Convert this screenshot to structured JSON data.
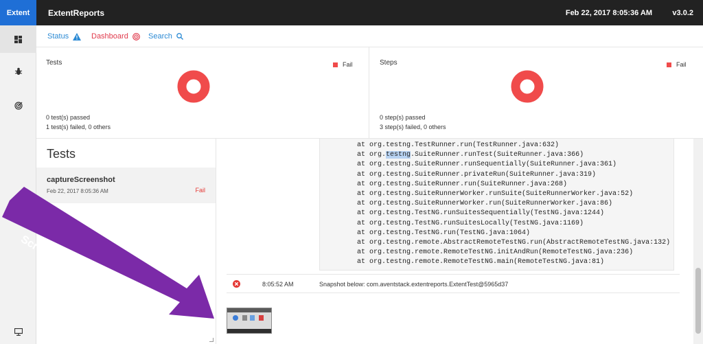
{
  "topbar": {
    "brand": "Extent",
    "title": "ExtentReports",
    "datetime": "Feb 22, 2017 8:05:36 AM",
    "version": "v3.0.2",
    "bg_color": "#222222",
    "brand_color": "#1f6fd6"
  },
  "sidebar": {
    "items": [
      {
        "icon": "dashboard-grid-icon",
        "active": true
      },
      {
        "icon": "bug-icon",
        "active": false
      },
      {
        "icon": "radar-icon",
        "active": false
      },
      {
        "icon": "monitor-icon",
        "active": false
      }
    ]
  },
  "subnav": {
    "status_label": "Status",
    "dashboard_label": "Dashboard",
    "search_label": "Search"
  },
  "tests_panel": {
    "title": "Tests",
    "legend": "Fail",
    "fail_fraction": 1.0,
    "passed_text": "0 test(s) passed",
    "failed_text": "1 test(s) failed, 0 others"
  },
  "steps_panel": {
    "title": "Steps",
    "legend": "Fail",
    "fail_fraction": 1.0,
    "passed_text": "0 step(s) passed",
    "failed_text": "3 step(s) failed, 0 others"
  },
  "fail_color": "#f04b4b",
  "test_list": {
    "heading": "Tests",
    "items": [
      {
        "name": "captureScreenshot",
        "date": "Feb 22, 2017 8:05:36 AM",
        "status": "Fail"
      }
    ]
  },
  "stacktrace": {
    "lines": [
      "at org.testng.TestRunner.run(TestRunner.java:632)",
      "at org.testng.SuiteRunner.runTest(SuiteRunner.java:366)",
      "at org.testng.SuiteRunner.runSequentially(SuiteRunner.java:361)",
      "at org.testng.SuiteRunner.privateRun(SuiteRunner.java:319)",
      "at org.testng.SuiteRunner.run(SuiteRunner.java:268)",
      "at org.testng.SuiteRunnerWorker.runSuite(SuiteRunnerWorker.java:52)",
      "at org.testng.SuiteRunnerWorker.run(SuiteRunnerWorker.java:86)",
      "at org.testng.TestNG.runSuitesSequentially(TestNG.java:1244)",
      "at org.testng.TestNG.runSuitesLocally(TestNG.java:1169)",
      "at org.testng.TestNG.run(TestNG.java:1064)",
      "at org.testng.remote.AbstractRemoteTestNG.run(AbstractRemoteTestNG.java:132)",
      "at org.testng.remote.RemoteTestNG.initAndRun(RemoteTestNG.java:236)",
      "at org.testng.remote.RemoteTestNG.main(RemoteTestNG.java:81)"
    ],
    "highlight_word": "testng"
  },
  "log": {
    "status_icon": "error-circle-icon",
    "time": "8:05:52 AM",
    "message": "Snapshot below: com.aventstack.extentreports.ExtentTest@5965d37"
  },
  "annotation": {
    "text": "Screenshot for the Failure Step",
    "color": "#7b2aa8"
  }
}
